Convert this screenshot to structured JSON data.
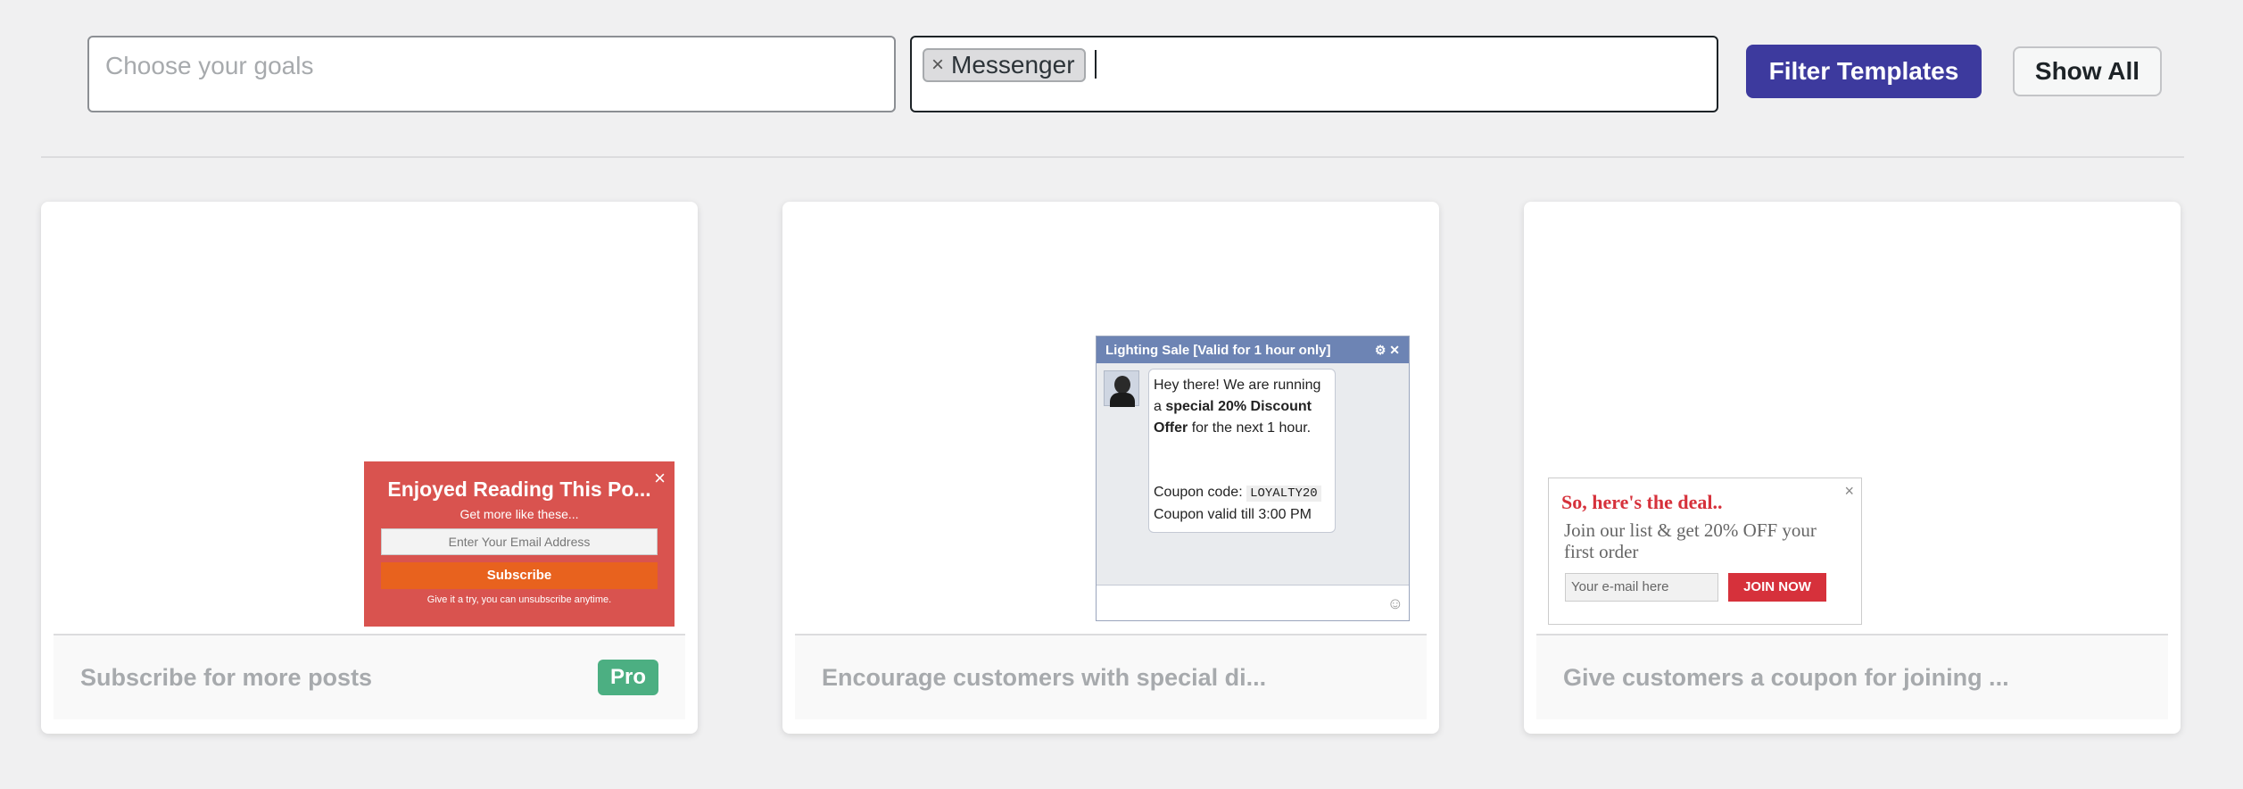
{
  "filters": {
    "goals_placeholder": "Choose your goals",
    "selected_tag": "Messenger",
    "tag_remove_symbol": "×",
    "filter_button": "Filter Templates",
    "show_all_button": "Show All"
  },
  "cards": [
    {
      "title": "Subscribe for more posts",
      "badge": "Pro",
      "preview": {
        "heading": "Enjoyed Reading This Po...",
        "subheading": "Get more like these...",
        "email_placeholder": "Enter Your Email Address",
        "button": "Subscribe",
        "fine_print": "Give it a try, you can unsubscribe anytime.",
        "close": "×"
      }
    },
    {
      "title": "Encourage customers with special di...",
      "preview": {
        "header": "Lighting Sale [Valid for 1 hour only]",
        "header_icons": "⚙ ✕",
        "line1": "Hey there! We are running a",
        "bold": "special 20% Discount Offer",
        "line2": "for the next 1 hour.",
        "coupon_label": "Coupon code:",
        "coupon_code": "LOYALTY20",
        "valid": "Coupon valid till 3:00 PM",
        "smiley": "☺"
      }
    },
    {
      "title": "Give customers a coupon for joining ...",
      "preview": {
        "heading": "So, here's the deal..",
        "text": "Join our list & get 20% OFF your first order",
        "email_placeholder": "Your e-mail here",
        "button": "JOIN NOW",
        "close": "×"
      }
    }
  ]
}
